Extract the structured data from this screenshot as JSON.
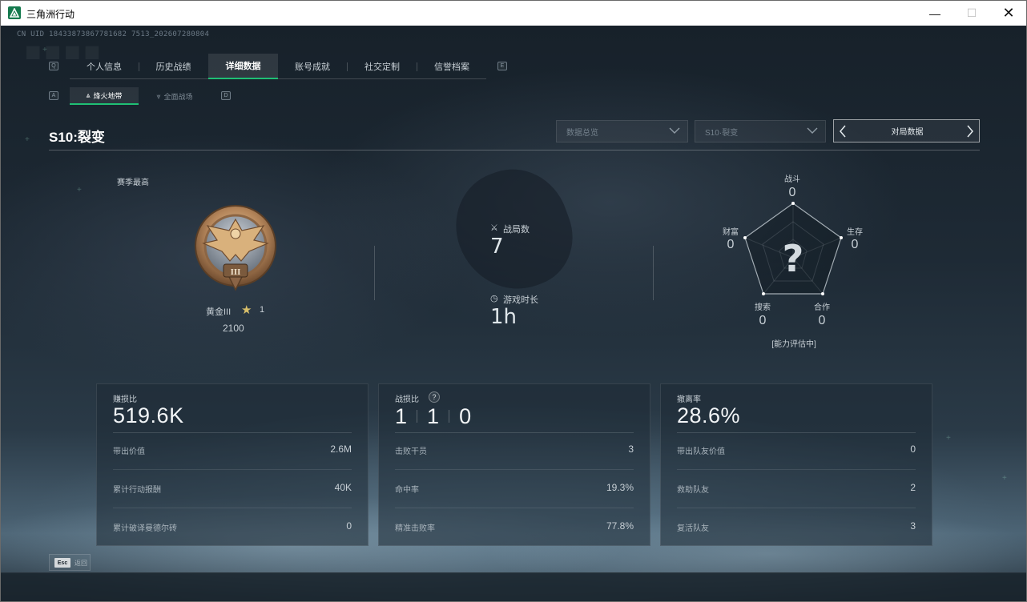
{
  "window": {
    "title": "三角洲行动",
    "minimize": "—",
    "maximize": "☐",
    "close": "✕"
  },
  "uid": "CN UID 18433873867781682 7513_202607280804",
  "tabs": {
    "prev_key": "Q",
    "next_key": "E",
    "items": [
      {
        "label": "个人信息"
      },
      {
        "label": "历史战绩"
      },
      {
        "label": "详细数据"
      },
      {
        "label": "账号成就"
      },
      {
        "label": "社交定制"
      },
      {
        "label": "信誉档案"
      }
    ],
    "active_index": 2
  },
  "subtabs": {
    "prev_key": "A",
    "next_key": "D",
    "items": [
      {
        "label": "烽火地带"
      },
      {
        "label": "全面战场"
      }
    ]
  },
  "season": {
    "title": "S10:裂变",
    "dropdown_view": "数据总览",
    "dropdown_season": "S10·裂变",
    "nav_label": "对局数据"
  },
  "rank": {
    "label": "赛季最高",
    "name": "黄金III",
    "stars": "1",
    "score": "2100",
    "tier_numeral": "III"
  },
  "summary": {
    "matches_label": "战局数",
    "matches_value": "7",
    "time_label": "游戏时长",
    "time_value": "1h"
  },
  "radar": {
    "axes": [
      {
        "label": "战斗",
        "value": "0"
      },
      {
        "label": "生存",
        "value": "0"
      },
      {
        "label": "合作",
        "value": "0"
      },
      {
        "label": "搜索",
        "value": "0"
      },
      {
        "label": "财富",
        "value": "0"
      }
    ],
    "center_symbol": "?",
    "status": "[能力评估中]"
  },
  "panels": {
    "profit": {
      "title": "赚损比",
      "value": "519.6K",
      "rows": [
        {
          "label": "带出价值",
          "value": "2.6M"
        },
        {
          "label": "累计行动报酬",
          "value": "40K"
        },
        {
          "label": "累计破译曼德尔砖",
          "value": "0"
        }
      ]
    },
    "combat": {
      "title": "战损比",
      "help": "?",
      "kd": [
        "1",
        "1",
        "0"
      ],
      "rows": [
        {
          "label": "击败干员",
          "value": "3"
        },
        {
          "label": "命中率",
          "value": "19.3%"
        },
        {
          "label": "精准击败率",
          "value": "77.8%"
        }
      ]
    },
    "extract": {
      "title": "撤离率",
      "value": "28.6%",
      "rows": [
        {
          "label": "带出队友价值",
          "value": "0"
        },
        {
          "label": "救助队友",
          "value": "2"
        },
        {
          "label": "复活队友",
          "value": "3"
        }
      ]
    }
  },
  "footer": {
    "esc_key": "Esc",
    "esc_label": "返回"
  },
  "colors": {
    "accent": "#1fbf74",
    "gold": "#d8bf6a"
  }
}
